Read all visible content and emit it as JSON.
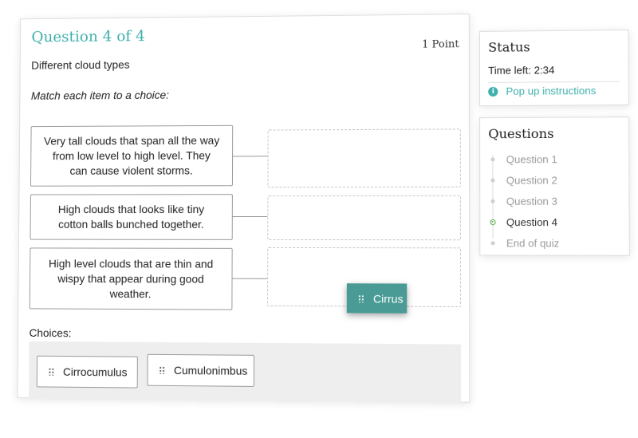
{
  "question": {
    "title": "Question 4 of 4",
    "points": "1 Point",
    "text": "Different cloud types",
    "instruction": "Match each item to a choice:"
  },
  "stems": [
    {
      "text": "Very tall clouds that span all the way from low level to high level. They can cause violent storms."
    },
    {
      "text": "High clouds that looks like tiny cotton balls bunched together."
    },
    {
      "text": "High level clouds that are thin and wispy that appear during good weather."
    }
  ],
  "choices": {
    "label": "Choices:",
    "items": [
      {
        "label": "Cirrocumulus",
        "icon": "grip-icon"
      },
      {
        "label": "Cumulonimbus",
        "icon": "grip-icon"
      }
    ]
  },
  "dragging": {
    "label": "Cirrus",
    "icon": "grip-icon",
    "color": "#4a9b95"
  },
  "status": {
    "title": "Status",
    "time_left": "Time left: 2:34",
    "popup_link": "Pop up instructions",
    "popup_icon": "info-icon"
  },
  "questions_nav": {
    "title": "Questions",
    "items": [
      {
        "label": "Question 1",
        "state": "visited"
      },
      {
        "label": "Question 2",
        "state": "visited"
      },
      {
        "label": "Question 3",
        "state": "visited"
      },
      {
        "label": "Question 4",
        "state": "current"
      },
      {
        "label": "End of quiz",
        "state": "visited"
      }
    ]
  },
  "colors": {
    "accent": "#3fb0ac",
    "current_marker": "#5aa84a",
    "drag_chip": "#4a9b95"
  }
}
